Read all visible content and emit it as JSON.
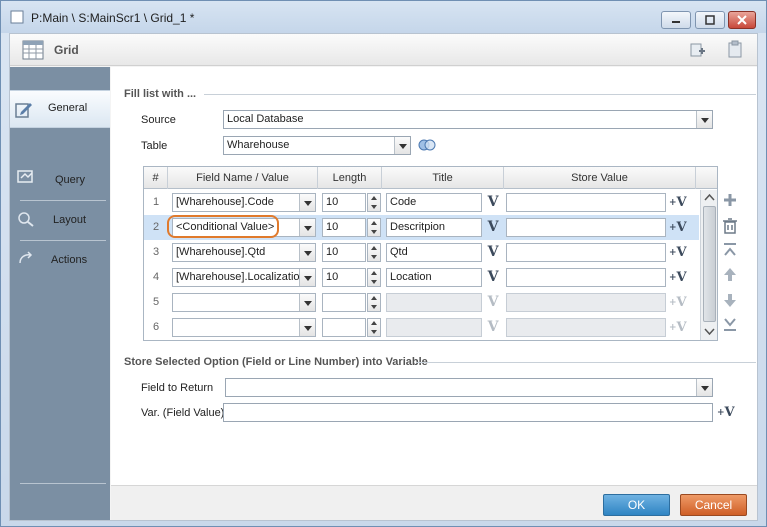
{
  "window": {
    "title": "P:Main \\ S:MainScr1 \\ Grid_1 *"
  },
  "header": {
    "title": "Grid"
  },
  "sidebar": {
    "items": [
      {
        "label": "General",
        "active": true,
        "icon": "edit-icon"
      },
      {
        "label": "Query",
        "active": false,
        "icon": "query-icon"
      },
      {
        "label": "Layout",
        "active": false,
        "icon": "layout-icon"
      },
      {
        "label": "Actions",
        "active": false,
        "icon": "actions-icon"
      }
    ]
  },
  "fill": {
    "section_label": "Fill list with ...",
    "source_label": "Source",
    "source_value": "Local Database",
    "table_label": "Table",
    "table_value": "Wharehouse"
  },
  "grid": {
    "columns": [
      "#",
      "Field Name / Value",
      "Length",
      "Title",
      "Store Value"
    ],
    "rows": [
      {
        "n": "1",
        "field": "[Wharehouse].Code",
        "length": "10",
        "title": "Code",
        "store": "",
        "enabled": true,
        "selected": false
      },
      {
        "n": "2",
        "field": "<Conditional Value>",
        "length": "10",
        "title": "Descritpion",
        "store": "",
        "enabled": true,
        "selected": true
      },
      {
        "n": "3",
        "field": "[Wharehouse].Qtd",
        "length": "10",
        "title": "Qtd",
        "store": "",
        "enabled": true,
        "selected": false
      },
      {
        "n": "4",
        "field": "[Wharehouse].Localization",
        "length": "10",
        "title": "Location",
        "store": "",
        "enabled": true,
        "selected": false
      },
      {
        "n": "5",
        "field": "",
        "length": "",
        "title": "",
        "store": "",
        "enabled": false,
        "selected": false
      },
      {
        "n": "6",
        "field": "",
        "length": "",
        "title": "",
        "store": "",
        "enabled": false,
        "selected": false
      }
    ]
  },
  "store": {
    "section_label": "Store Selected Option (Field or Line Number) into Variable",
    "field_to_return_label": "Field to Return",
    "field_to_return_value": "",
    "var_label": "Var. (Field Value)",
    "var_value": ""
  },
  "buttons": {
    "ok": "OK",
    "cancel": "Cancel"
  },
  "colors": {
    "accent": "#2f84c3",
    "cancel": "#cf5f26",
    "highlight": "#e07a2c",
    "sidebar": "#7b8fa3"
  }
}
